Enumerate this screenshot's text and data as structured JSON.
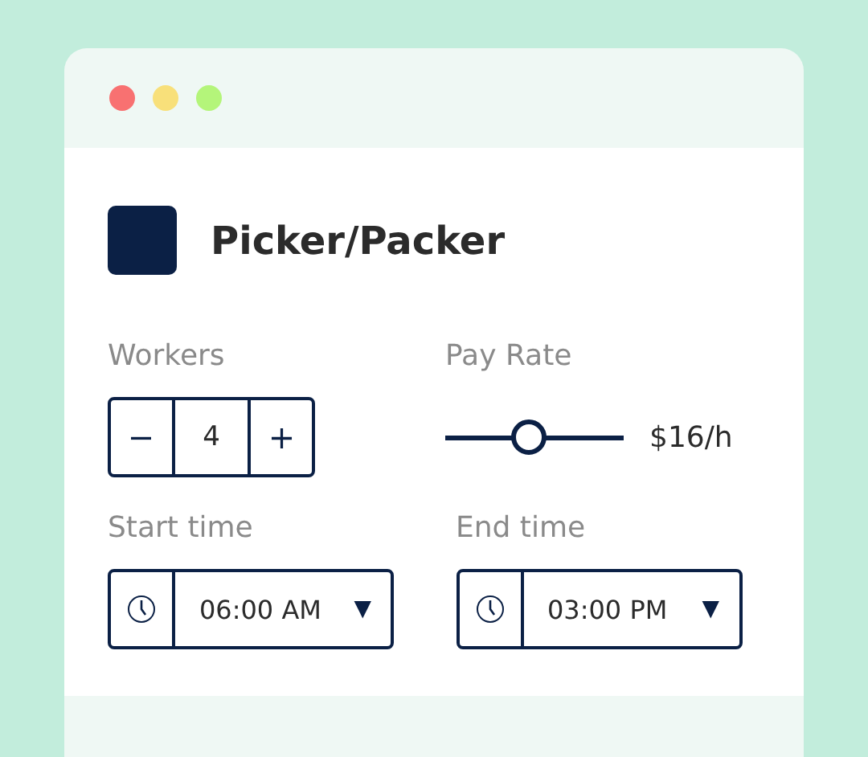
{
  "window": {
    "title": "Picker/Packer"
  },
  "workers": {
    "label": "Workers",
    "decrement": "−",
    "value": "4",
    "increment": "+"
  },
  "pay_rate": {
    "label": "Pay Rate",
    "level": 0.47,
    "reading": "$16/h"
  },
  "times": [
    {
      "label": "Start time",
      "value": "06:00 AM",
      "arrow": "▼"
    },
    {
      "label": "End time",
      "value": "03:00 PM",
      "arrow": "▼"
    }
  ]
}
